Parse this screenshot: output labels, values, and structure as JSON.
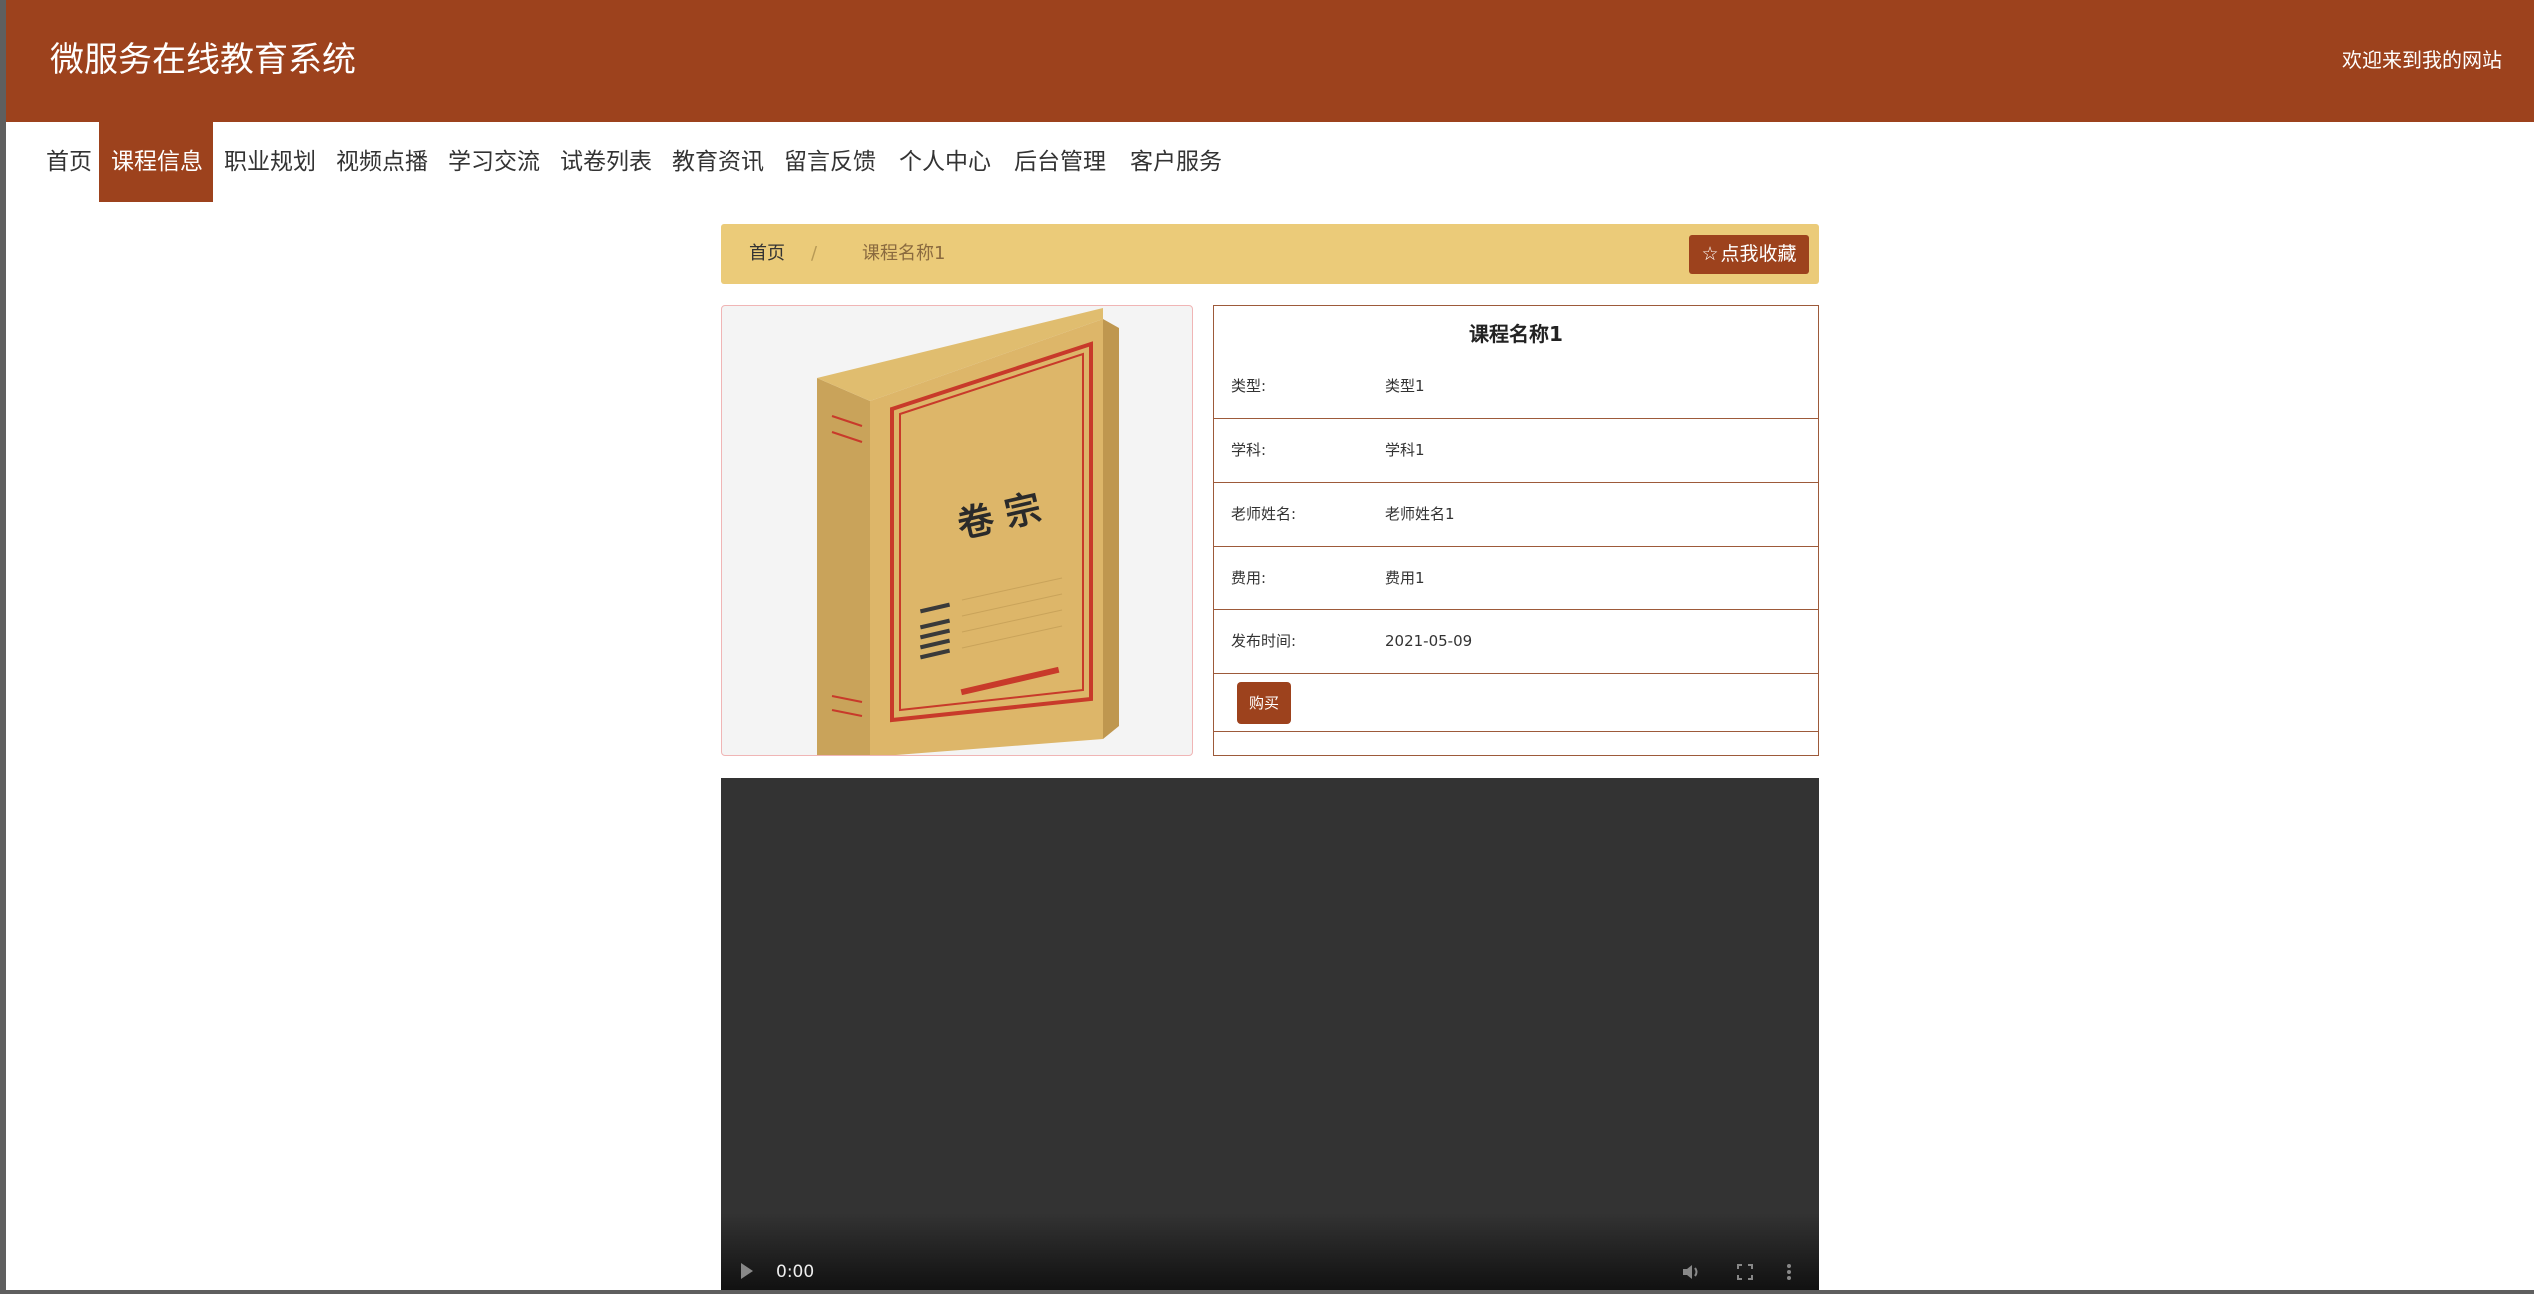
{
  "header": {
    "site_title": "微服务在线教育系统",
    "welcome": "欢迎来到我的网站",
    "brand_color": "#9d421d"
  },
  "nav": {
    "items": [
      {
        "label": "首页",
        "active": false
      },
      {
        "label": "课程信息",
        "active": true
      },
      {
        "label": "职业规划",
        "active": false
      },
      {
        "label": "视频点播",
        "active": false
      },
      {
        "label": "学习交流",
        "active": false
      },
      {
        "label": "试卷列表",
        "active": false
      },
      {
        "label": "教育资讯",
        "active": false
      },
      {
        "label": "留言反馈",
        "active": false
      },
      {
        "label": "个人中心",
        "active": false
      },
      {
        "label": "后台管理",
        "active": false
      },
      {
        "label": "客户服务",
        "active": false
      }
    ]
  },
  "breadcrumb": {
    "home": "首页",
    "separator": "/",
    "current": "课程名称1"
  },
  "favorite_button": {
    "icon": "star-outline-icon",
    "label": "点我收藏"
  },
  "course_image": {
    "cover_text": "卷 宗",
    "icon": "archive-box-image"
  },
  "detail": {
    "title": "课程名称1",
    "fields": [
      {
        "label": "类型:",
        "value": "类型1"
      },
      {
        "label": "学科:",
        "value": "学科1"
      },
      {
        "label": "老师姓名:",
        "value": "老师姓名1"
      },
      {
        "label": "费用:",
        "value": "费用1"
      },
      {
        "label": "发布时间:",
        "value": "2021-05-09"
      }
    ],
    "buy_label": "购买"
  },
  "video": {
    "time": "0:00"
  },
  "colors": {
    "accent": "#9d421d",
    "breadcrumb_bg": "#ebcb79"
  }
}
